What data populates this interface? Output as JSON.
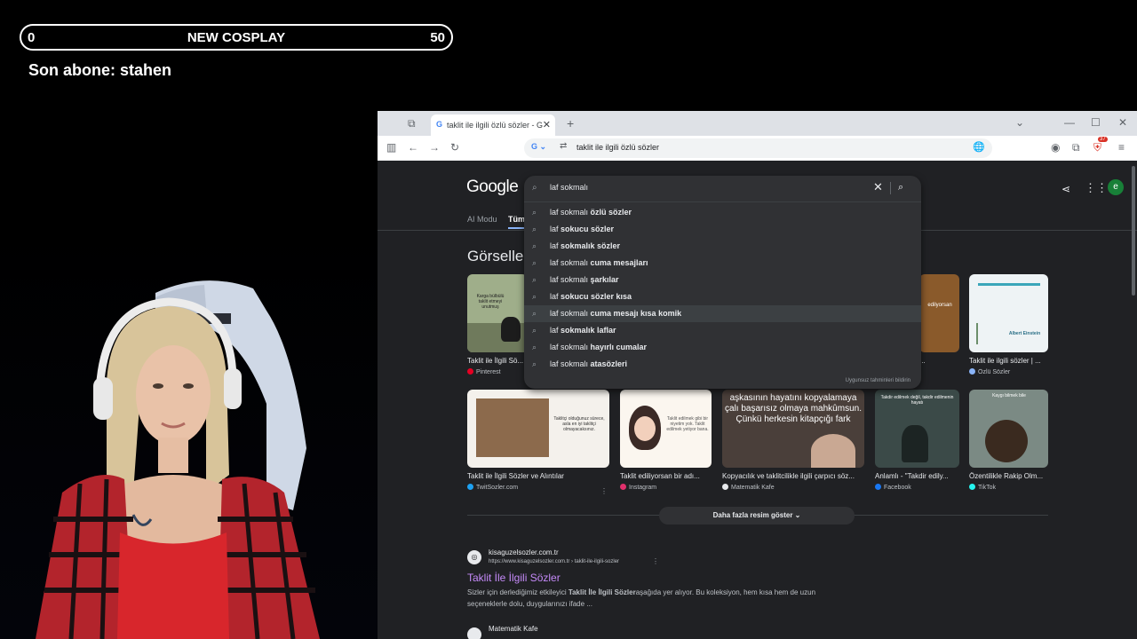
{
  "overlay": {
    "goal_start": "0",
    "goal_title": "NEW COSPLAY",
    "goal_end": "50",
    "last_sub": "Son abone: stahen"
  },
  "browser": {
    "tab_title": "taklit ile ilgili özlü sözler - Goog",
    "tab_close": "✕",
    "new_tab": "+",
    "address": "taklit ile ilgili özlü sözler",
    "extension_badge": "37",
    "window_controls": {
      "minimize": "—",
      "maximize": "☐",
      "close": "✕"
    }
  },
  "google": {
    "logo": "Google",
    "nav_ai": "AI Modu",
    "nav_all": "Tümü",
    "avatar_letter": "e",
    "query": "laf sokmalı",
    "suggestions": [
      {
        "prefix": "laf sokmalı",
        "bold": " özlü sözler"
      },
      {
        "prefix": "laf ",
        "bold": "sokucu sözler"
      },
      {
        "prefix": "laf ",
        "bold": "sokmalık sözler"
      },
      {
        "prefix": "laf sokmalı",
        "bold": " cuma mesajları"
      },
      {
        "prefix": "laf sokmalı",
        "bold": " şarkılar"
      },
      {
        "prefix": "laf ",
        "bold": "sokucu sözler kısa"
      },
      {
        "prefix": "laf sokmalı",
        "bold": " cuma mesajı kısa komik"
      },
      {
        "prefix": "laf ",
        "bold": "sokmalık laflar"
      },
      {
        "prefix": "laf sokmalı",
        "bold": " hayırlı cumalar"
      },
      {
        "prefix": "laf sokmalı",
        "bold": " atasözleri"
      }
    ],
    "report_text": "Uygunsuz tahminleri bildirin",
    "images_title": "Görseller",
    "images_row1": [
      {
        "caption": "Taklit ile İlgili Sö...",
        "source": "Pinterest",
        "thumb_text": "Karga bülbülü taklit etmeyi unutmuş"
      },
      {
        "caption": "...",
        "source": "",
        "thumb_text": "edilyorsan"
      },
      {
        "caption": "Taklit ile ilgili sözler | ...",
        "source": "Özlü Sözler",
        "thumb_text": "Albert Einstein"
      }
    ],
    "images_row2": [
      {
        "caption": "Taklit ile İlgili Sözler ve Alıntılar",
        "source": "TwitSozler.com",
        "thumb_text": "Taklitçi olduğunuz sürece, asla en iyi taklitçi olmayacaksınız."
      },
      {
        "caption": "Taklit ediliyorsan bir adı...",
        "source": "Instagram",
        "thumb_text": "Taklit edilmek gibi bir niyetim yok. Taklit edilmek yetiyor bana."
      },
      {
        "caption": "Kopyacılık ve taklitcilikle ilgili çarpıcı söz...",
        "source": "Matematik Kafe",
        "thumb_text": "aşkasının hayatını kopyalamaya çalı başarısız olmaya mahkûmsun. Çünkü herkesin kitapçığı fark"
      },
      {
        "caption": "Anlamlı - \"Takdir edily...",
        "source": "Facebook",
        "thumb_text": "Takdir edilmek değil, takdir edilmenin hayatı"
      },
      {
        "caption": "Özentilikle Rakip Olm...",
        "source": "TikTok",
        "thumb_text": "Kaygı bilmek bile"
      }
    ],
    "more_images": "Daha fazla resim göster",
    "result": {
      "site": "kisaguzelsozler.com.tr",
      "url": "https://www.kisaguzelsozler.com.tr › taklit-ile-ilgili-sozler",
      "title": "Taklit İle İlgili Sözler",
      "snippet_before": "Sizler için derlediğimiz etkileyici ",
      "snippet_bold": "Taklit İle İlgili Sözler",
      "snippet_after": "aşağıda yer alıyor. Bu koleksiyon, hem kısa hem de uzun seçeneklerle dolu, duygularınızı ifade ..."
    },
    "result2_site": "Matematik Kafe"
  },
  "colors": {
    "page_bg": "#202124",
    "dropdown_bg": "#303134",
    "link_visited": "#c58af9"
  }
}
